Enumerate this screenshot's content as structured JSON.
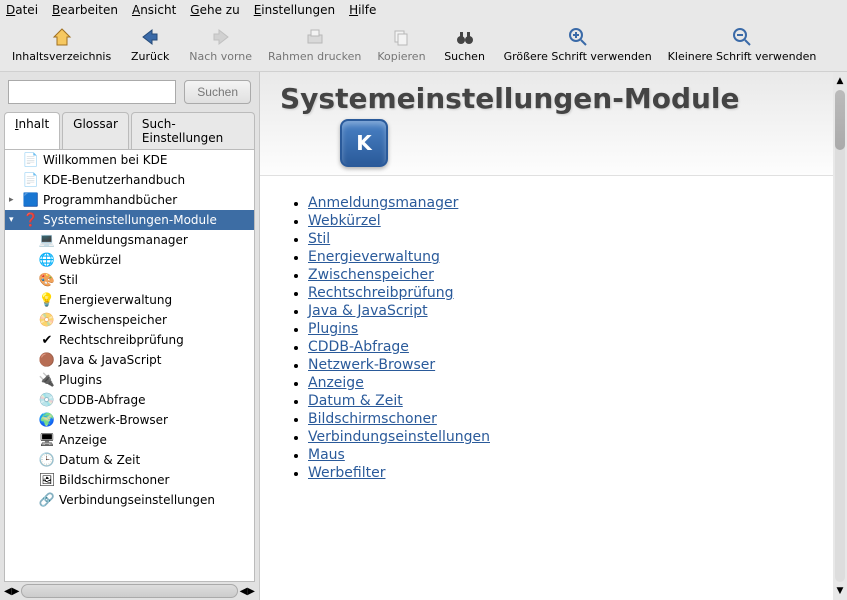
{
  "menu": {
    "file": "Datei",
    "edit": "Bearbeiten",
    "view": "Ansicht",
    "go": "Gehe zu",
    "settings": "Einstellungen",
    "help": "Hilfe"
  },
  "toolbar": {
    "toc": "Inhaltsverzeichnis",
    "back": "Zurück",
    "forward": "Nach vorne",
    "print": "Rahmen drucken",
    "copy": "Kopieren",
    "find": "Suchen",
    "zoom_in": "Größere Schrift verwenden",
    "zoom_out": "Kleinere Schrift verwenden"
  },
  "search": {
    "placeholder": "",
    "button": "Suchen"
  },
  "tabs": {
    "content": "Inhalt",
    "glossary": "Glossar",
    "search_settings": "Such-Einstellungen"
  },
  "tree": [
    {
      "label": "Willkommen bei KDE",
      "level": 1,
      "icon": "doc"
    },
    {
      "label": "KDE-Benutzerhandbuch",
      "level": 1,
      "icon": "doc"
    },
    {
      "label": "Programmhandbücher",
      "level": 1,
      "icon": "kde",
      "expandable": true
    },
    {
      "label": "Systemeinstellungen-Module",
      "level": 1,
      "icon": "help",
      "selected": true,
      "expandable": true,
      "expanded": true
    },
    {
      "label": "Anmeldungsmanager",
      "level": 2,
      "icon": "login"
    },
    {
      "label": "Webkürzel",
      "level": 2,
      "icon": "web"
    },
    {
      "label": "Stil",
      "level": 2,
      "icon": "style"
    },
    {
      "label": "Energieverwaltung",
      "level": 2,
      "icon": "power"
    },
    {
      "label": "Zwischenspeicher",
      "level": 2,
      "icon": "cache"
    },
    {
      "label": "Rechtschreibprüfung",
      "level": 2,
      "icon": "spell"
    },
    {
      "label": "Java & JavaScript",
      "level": 2,
      "icon": "java"
    },
    {
      "label": "Plugins",
      "level": 2,
      "icon": "plugin"
    },
    {
      "label": "CDDB-Abfrage",
      "level": 2,
      "icon": "cddb"
    },
    {
      "label": "Netzwerk-Browser",
      "level": 2,
      "icon": "net"
    },
    {
      "label": "Anzeige",
      "level": 2,
      "icon": "display"
    },
    {
      "label": "Datum & Zeit",
      "level": 2,
      "icon": "clock"
    },
    {
      "label": "Bildschirmschoner",
      "level": 2,
      "icon": "screensaver"
    },
    {
      "label": "Verbindungseinstellungen",
      "level": 2,
      "icon": "connection"
    }
  ],
  "page": {
    "title": "Systemeinstellungen-Module",
    "links": [
      "Anmeldungsmanager",
      "Webkürzel",
      "Stil",
      "Energieverwaltung",
      "Zwischenspeicher",
      "Rechtschreibprüfung",
      "Java & JavaScript",
      "Plugins",
      "CDDB-Abfrage",
      "Netzwerk-Browser",
      "Anzeige",
      "Datum & Zeit",
      "Bildschirmschoner",
      "Verbindungseinstellungen",
      "Maus",
      "Werbefilter"
    ]
  },
  "icons": {
    "doc": "📄",
    "kde": "🟦",
    "help": "❓",
    "login": "💻",
    "web": "🌐",
    "style": "🎨",
    "power": "💡",
    "cache": "📀",
    "spell": "✔",
    "java": "🟤",
    "plugin": "🔌",
    "cddb": "💿",
    "net": "🌍",
    "display": "🖥",
    "clock": "🕒",
    "screensaver": "🖼",
    "connection": "🔗"
  }
}
